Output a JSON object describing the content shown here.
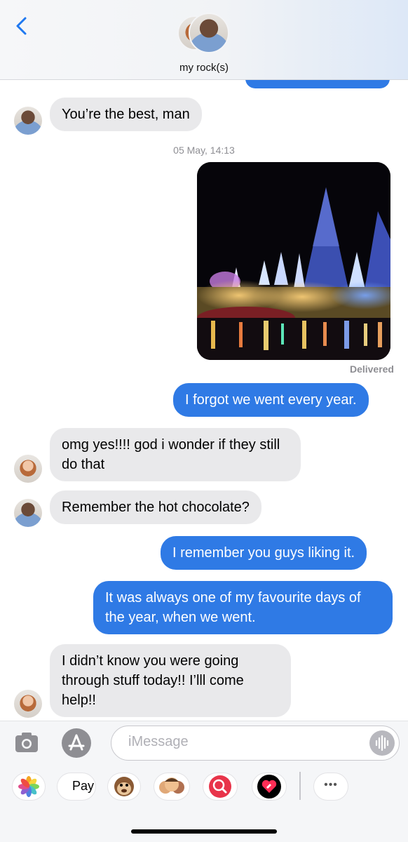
{
  "header": {
    "contact_name": "my rock(s)"
  },
  "messages": [
    {
      "side": "in",
      "text": "You’re the best, man",
      "avatar": "man"
    },
    {
      "timestamp": "05 May, 14:13"
    },
    {
      "side": "out",
      "type": "photo"
    },
    {
      "status": "Delivered"
    },
    {
      "side": "out",
      "text": "I forgot we went every year."
    },
    {
      "side": "in",
      "text": "omg yes!!!! god i wonder if they still do that",
      "avatar": "woman"
    },
    {
      "side": "in",
      "text": "Remember the hot chocolate?",
      "avatar": "man"
    },
    {
      "side": "out",
      "text": "I remember you guys liking it."
    },
    {
      "side": "out",
      "text": "It was always one of my favourite days of the year, when we went."
    },
    {
      "side": "in",
      "text": "I didn’t know you were going through stuff today!! I’lll come help!!",
      "avatar": "woman"
    }
  ],
  "composer": {
    "placeholder": "iMessage"
  },
  "app_drawer": {
    "apple_pay_label": "Pay",
    "more_label": "•••"
  },
  "colors": {
    "outgoing": "#2f7ae5",
    "incoming": "#e9e9eb",
    "accent": "#1f78f0"
  }
}
